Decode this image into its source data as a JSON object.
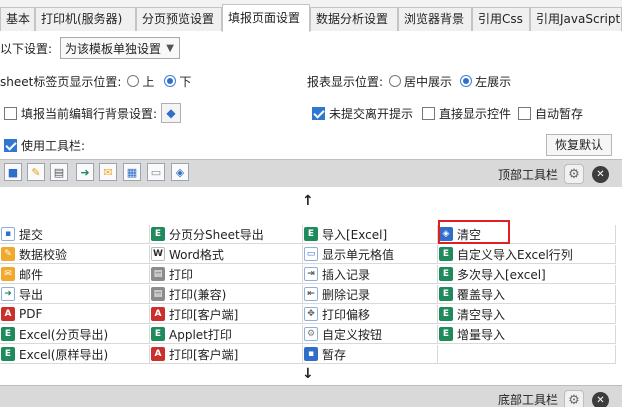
{
  "tabs": [
    {
      "label": "基本",
      "active": false
    },
    {
      "label": "打印机(服务器)",
      "active": false
    },
    {
      "label": "分页预览设置",
      "active": false
    },
    {
      "label": "填报页面设置",
      "active": true
    },
    {
      "label": "数据分析设置",
      "active": false
    },
    {
      "label": "浏览器背景",
      "active": false
    },
    {
      "label": "引用Css",
      "active": false
    },
    {
      "label": "引用JavaScript",
      "active": false
    }
  ],
  "settings": {
    "template_label": "以下设置:",
    "template_select": "为该模板单独设置",
    "sheet_position_label": "sheet标签页显示位置:",
    "sheet_top": "上",
    "sheet_bottom": "下",
    "sheet_selected": "下",
    "report_position_label": "报表显示位置:",
    "report_center": "居中展示",
    "report_left": "左展示",
    "report_selected": "左展示",
    "fill_bg_label": "填报当前编辑行背景设置:",
    "fill_bg_checked": false,
    "unsubmitted_label": "未提交离开提示",
    "unsubmitted_checked": true,
    "direct_show_label": "直接显示控件",
    "direct_show_checked": false,
    "auto_save_label": "自动暂存",
    "auto_save_checked": false,
    "use_toolbar_label": "使用工具栏:",
    "use_toolbar_checked": true,
    "restore_default": "恢复默认"
  },
  "top_toolbar": {
    "title": "顶部工具栏",
    "icons": [
      "save-icon",
      "edit-icon",
      "print-icon",
      "export-icon",
      "mail-icon",
      "layout-icon",
      "page-icon",
      "eraser-icon"
    ]
  },
  "bottom_toolbar": {
    "title": "底部工具栏"
  },
  "arrows": {
    "up": "↑",
    "down": "↓"
  },
  "button_grid": {
    "columns": [
      [
        {
          "label": "提交",
          "icon": "save-icon"
        },
        {
          "label": "数据校验",
          "icon": "pencil-icon"
        },
        {
          "label": "邮件",
          "icon": "mail-icon"
        },
        {
          "label": "导出",
          "icon": "export-icon"
        },
        {
          "label": "PDF",
          "icon": "pdf-icon"
        },
        {
          "label": "Excel(分页导出)",
          "icon": "excel-icon"
        },
        {
          "label": "Excel(原样导出)",
          "icon": "excel-icon"
        }
      ],
      [
        {
          "label": "分页分Sheet导出",
          "icon": "excel-icon"
        },
        {
          "label": "Word格式",
          "icon": "word-icon"
        },
        {
          "label": "打印",
          "icon": "print-icon"
        },
        {
          "label": "打印(兼容)",
          "icon": "print-icon"
        },
        {
          "label": "打印[客户端]",
          "icon": "pdf-icon"
        },
        {
          "label": "Applet打印",
          "icon": "excel-icon"
        },
        {
          "label": "打印[客户端]",
          "icon": "pdf-icon"
        }
      ],
      [
        {
          "label": "导入[Excel]",
          "icon": "excel-icon"
        },
        {
          "label": "显示单元格值",
          "icon": "page-icon"
        },
        {
          "label": "插入记录",
          "icon": "insert-icon"
        },
        {
          "label": "删除记录",
          "icon": "delete-icon"
        },
        {
          "label": "打印偏移",
          "icon": "move-icon"
        },
        {
          "label": "自定义按钮",
          "icon": "gear-icon"
        },
        {
          "label": "暂存",
          "icon": "save-icon"
        }
      ],
      [
        {
          "label": "清空",
          "icon": "eraser-icon"
        },
        {
          "label": "自定义导入Excel行列",
          "icon": "excel-icon"
        },
        {
          "label": "多次导入[excel]",
          "icon": "excel-icon"
        },
        {
          "label": "覆盖导入",
          "icon": "excel-icon"
        },
        {
          "label": "清空导入",
          "icon": "excel-icon"
        },
        {
          "label": "增量导入",
          "icon": "excel-icon"
        },
        {
          "label": "",
          "icon": ""
        }
      ]
    ]
  },
  "colors": {
    "highlight": "#e02020",
    "accent": "#2f6fca",
    "excel": "#1f8a5b"
  }
}
